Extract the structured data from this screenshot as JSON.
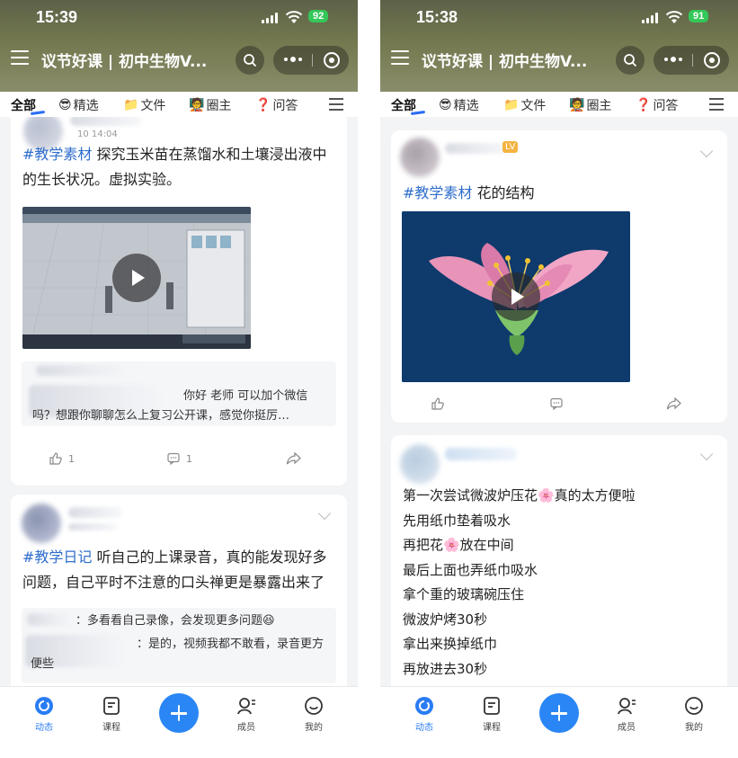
{
  "screens": [
    {
      "status": {
        "time": "15:39",
        "battery": "92"
      },
      "navbar": {
        "title": "议节好课 | 初中生物V..."
      },
      "tabs": [
        {
          "label": "全部",
          "emoji": ""
        },
        {
          "label": "精选",
          "emoji": "😎"
        },
        {
          "label": "文件",
          "emoji": "📁"
        },
        {
          "label": "圈主",
          "emoji": "🧑‍🏫"
        },
        {
          "label": "问答",
          "emoji": "❓"
        }
      ],
      "posts": [
        {
          "time": "10 14:04",
          "tag": "#教学素材",
          "text": " 探究玉米苗在蒸馏水和土壤浸出液中的生长状况。虚拟实验。",
          "comments": [
            {
              "text": "你好  老师   可以加个微信吗？想跟你聊聊怎么上复习公开课，感觉你挺厉…"
            }
          ],
          "likes": "1",
          "comment_count": "1"
        },
        {
          "time": "",
          "tag": "#教学日记",
          "text": " 听自己的上课录音，真的能发现好多问题，自己平时不注意的口头禅更是暴露出来了",
          "comments": [
            {
              "text": "：多看看自己录像，会发现更多问题😆"
            },
            {
              "text": "：是的，视频我都不敢看，录音更方便些"
            }
          ]
        }
      ]
    },
    {
      "status": {
        "time": "15:38",
        "battery": "91"
      },
      "navbar": {
        "title": "议节好课 | 初中生物V..."
      },
      "tabs": [
        {
          "label": "全部",
          "emoji": ""
        },
        {
          "label": "精选",
          "emoji": "😎"
        },
        {
          "label": "文件",
          "emoji": "📁"
        },
        {
          "label": "圈主",
          "emoji": "🧑‍🏫"
        },
        {
          "label": "问答",
          "emoji": "❓"
        }
      ],
      "posts": [
        {
          "tag": "#教学素材",
          "text": " 花的结构"
        },
        {
          "lines": [
            "第一次尝试微波炉压花🌸真的太方便啦",
            "先用纸巾垫着吸水",
            "再把花🌸放在中间",
            "最后上面也弄纸巾吸水",
            "拿个重的玻璃碗压住",
            "微波炉烤30秒",
            "拿出来换掉纸巾",
            "再放进去30秒"
          ]
        }
      ]
    }
  ],
  "bottom_nav": [
    {
      "label": "动态",
      "icon": "feed-icon",
      "active": true
    },
    {
      "label": "课程",
      "icon": "course-icon",
      "active": false
    },
    {
      "label": "",
      "icon": "plus-icon",
      "active": false
    },
    {
      "label": "成员",
      "icon": "members-icon",
      "active": false
    },
    {
      "label": "我的",
      "icon": "profile-icon",
      "active": false
    }
  ],
  "colors": {
    "accent": "#2a86f4",
    "tag": "#2f6ecc",
    "battery": "#34c759"
  }
}
